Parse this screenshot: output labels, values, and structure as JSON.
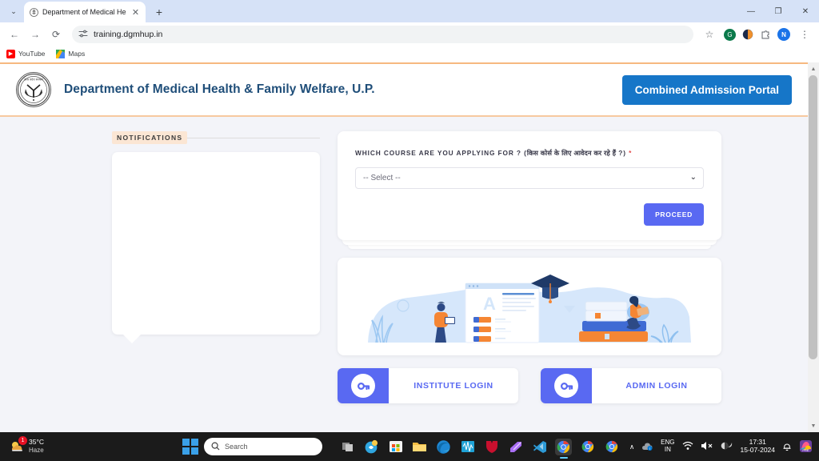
{
  "browser": {
    "tab": {
      "title": "Department of Medical Health &",
      "favicon": "emblem-icon",
      "close": "✕"
    },
    "tab_dropdown": "⌄",
    "new_tab": "+",
    "window_controls": {
      "minimize": "—",
      "maximize": "❐",
      "close": "✕"
    },
    "nav": {
      "back": "←",
      "forward": "→",
      "reload": "⟳"
    },
    "omnibox": {
      "site_settings_icon": "tune-icon",
      "url": "training.dgmhup.in",
      "star": "☆"
    },
    "extensions": [
      {
        "name": "grammarly-extension-icon",
        "glyph": "G",
        "color": "#0b7a4b"
      },
      {
        "name": "adblock-extension-icon",
        "glyph": "◔",
        "color": "#f0912d"
      },
      {
        "name": "extensions-puzzle-icon",
        "glyph": "⬚",
        "color": "#5f6368"
      }
    ],
    "profile_avatar": "N",
    "menu_icon": "⋮",
    "bookmarks": [
      {
        "label": "YouTube",
        "icon": "youtube-icon"
      },
      {
        "label": "Maps",
        "icon": "google-maps-icon"
      }
    ]
  },
  "site": {
    "header": {
      "emblem_alt": "uttar-pradesh-state-emblem",
      "title": "Department of Medical Health & Family Welfare, U.P.",
      "portal_button": "Combined Admission Portal",
      "portal_button_color": "#1676c8",
      "accent_top": "#f6b980"
    },
    "notifications": {
      "label": "NOTIFICATIONS",
      "items": []
    },
    "form": {
      "label_en": "WHICH COURSE ARE YOU APPLYING FOR ? (",
      "label_hi": "किस कोर्स के लिए आवेदन कर रहे हैं",
      "label_tail": " ?)",
      "required_mark": "*",
      "select_value": "-- Select --",
      "select_options": [
        "-- Select --"
      ],
      "chevron": "⌄",
      "proceed_label": "PROCEED",
      "proceed_color": "#5969f2"
    },
    "illustration": {
      "alt": "online-education-illustration"
    },
    "logins": [
      {
        "label": "INSTITUTE LOGIN",
        "icon": "key-icon"
      },
      {
        "label": "ADMIN LOGIN",
        "icon": "key-icon"
      }
    ]
  },
  "taskbar": {
    "weather": {
      "temp": "35°C",
      "condition": "Haze",
      "badge": "1",
      "icon": "sun-cloud-icon"
    },
    "start": "windows-start-icon",
    "search_placeholder": "Search",
    "search_icon": "⌕",
    "apps": [
      {
        "name": "task-view-icon",
        "glyph": "❐",
        "color": "#c8c8c8"
      },
      {
        "name": "copilot-icon",
        "glyph": "◔",
        "color": "#2fa6e0"
      },
      {
        "name": "microsoft-store-icon",
        "glyph": "⊞",
        "color": "#f2f2f2"
      },
      {
        "name": "file-explorer-icon",
        "glyph": "▬",
        "color": "#f5bc42"
      },
      {
        "name": "microsoft-edge-icon",
        "glyph": "◎",
        "color": "#1e88d4"
      },
      {
        "name": "audio-editor-icon",
        "glyph": "≈",
        "color": "#1fa2d6"
      },
      {
        "name": "mcafee-icon",
        "glyph": "▼",
        "color": "#c8102e"
      },
      {
        "name": "clipchamp-icon",
        "glyph": "▰",
        "color": "#a96ef5"
      },
      {
        "name": "vs-code-icon",
        "glyph": "⌨",
        "color": "#2d9ad6"
      },
      {
        "name": "google-chrome-icon",
        "glyph": "◉",
        "color": "#4285f4",
        "active": true
      },
      {
        "name": "google-chrome-icon",
        "glyph": "◉",
        "color": "#4285f4"
      },
      {
        "name": "google-chrome-icon",
        "glyph": "◉",
        "color": "#4285f4"
      }
    ],
    "tray": {
      "chevron": "∧",
      "onedrive": "onedrive-icon",
      "language": {
        "line1": "ENG",
        "line2": "IN"
      },
      "wifi": "◠",
      "volume": "✕",
      "battery": "battery-icon",
      "time": "17:31",
      "date": "15-07-2024",
      "bell": "△",
      "app": "colorful-app-icon"
    }
  }
}
